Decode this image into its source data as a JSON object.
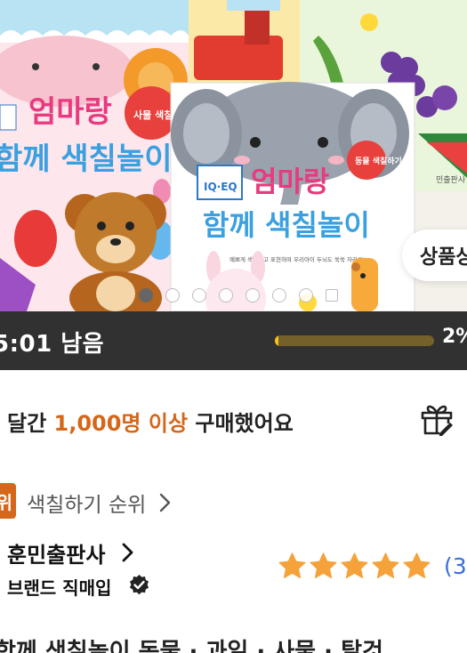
{
  "hero": {
    "cover_back": {
      "title_line1": "엄마랑",
      "title_line2": "함께 색칠놀이",
      "tag": "사물 색칠하기",
      "badge": "IQ·EQ"
    },
    "cover_front": {
      "title_line1": "엄마랑",
      "title_line2": "함께 색칠놀이",
      "tag": "동물 색칠하기",
      "badge": "IQ·EQ",
      "subtitle": "예쁘게 색칠하고 표현하며 우리아이 두뇌도 쑥쑥 자라요!"
    },
    "cover_right": {
      "caption": "민출판사"
    },
    "carousel": {
      "total_dots": 8,
      "active_index": 0
    },
    "detail_button": "상품상세"
  },
  "timer": {
    "remaining_text": "5:01 남음",
    "progress_percent_label": "2%",
    "progress_fraction": 0.02,
    "colors": {
      "track": "#74602a",
      "fill": "#f6c21a"
    }
  },
  "purchases": {
    "prefix": "달간 ",
    "highlight": "1,000명 이상",
    "suffix": " 구매했어요",
    "highlight_color": "#d4671a",
    "icon": "gift-icon"
  },
  "ranking": {
    "badge": "위",
    "label": "색칠하기 순위",
    "icon": "chevron-right-icon"
  },
  "seller": {
    "name": "훈민출판사",
    "brand_label": "브랜드 직매입",
    "verified_icon": "verified-check-icon",
    "rating_stars": 5,
    "review_count": "(3",
    "star_color": "#f5a23a"
  },
  "product": {
    "title": "함께 색칠놀이 동물 · 과일 · 사물 · 탈것"
  }
}
